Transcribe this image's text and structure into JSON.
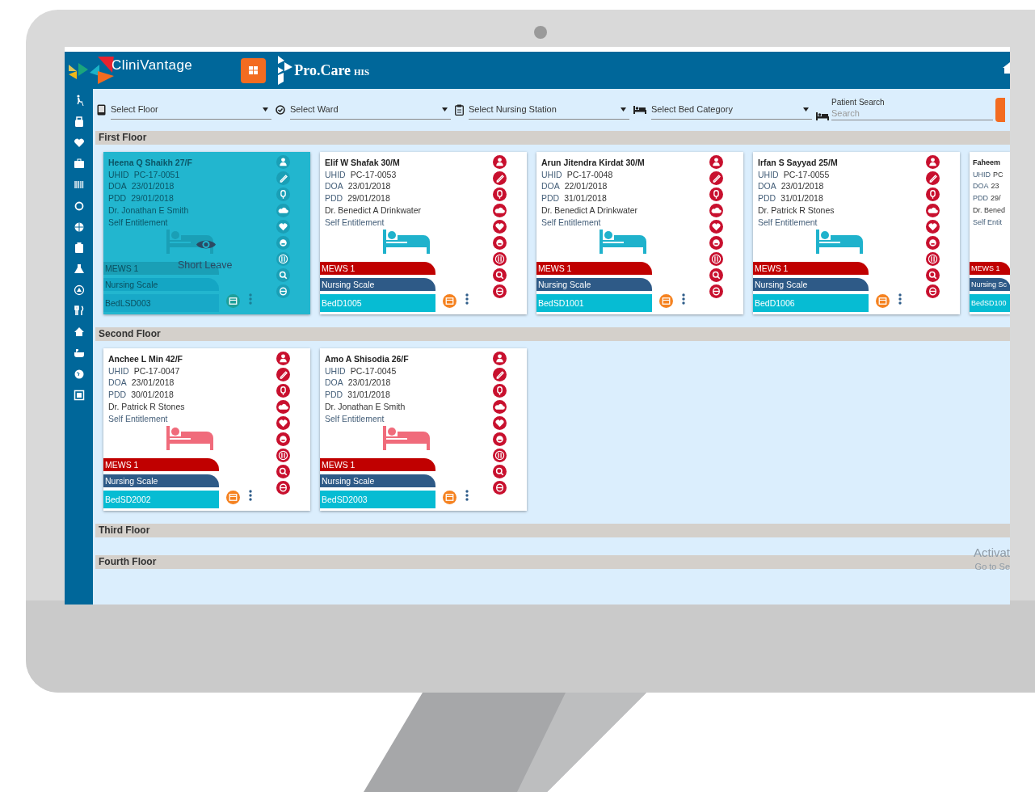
{
  "header": {
    "logo_text": "CliniVantage",
    "brand": "Pro.Care",
    "brand_suffix": "HIS"
  },
  "filters": [
    {
      "placeholder": "Select Floor"
    },
    {
      "placeholder": "Select Ward"
    },
    {
      "placeholder": "Select Nursing Station"
    },
    {
      "placeholder": "Select Bed Category"
    }
  ],
  "patient_search": {
    "label": "Patient Search",
    "placeholder": "Search"
  },
  "floors": [
    {
      "title": "First Floor",
      "cards": [
        {
          "kind": "full",
          "name": "Heena Q Shaikh 27/F",
          "uhid_label": "UHID",
          "uhid": "PC-17-0051",
          "doa_label": "DOA",
          "doa": "23/01/2018",
          "pdd_label": "PDD",
          "pdd": "29/01/2018",
          "doctor": "Dr. Jonathan E Smith",
          "entitlement": "Self Entitlement",
          "mews": "MEWS 1",
          "nursing": "Nursing Scale",
          "bed": "BedLSD003",
          "color": "#1a9fb6",
          "short_leave": true,
          "overlay_text": "Short Leave"
        },
        {
          "kind": "full",
          "name": "Elif W Shafak 30/M",
          "uhid_label": "UHID",
          "uhid": "PC-17-0053",
          "doa_label": "DOA",
          "doa": "23/01/2018",
          "pdd_label": "PDD",
          "pdd": "29/01/2018",
          "doctor": "Dr. Benedict A Drinkwater",
          "entitlement": "Self Entitlement",
          "mews": "MEWS 1",
          "nursing": "Nursing Scale",
          "bed": "BedD1005",
          "color": "#1fb2cc",
          "short_leave": false
        },
        {
          "kind": "full",
          "name": "Arun Jitendra Kirdat 30/M",
          "uhid_label": "UHID",
          "uhid": "PC-17-0048",
          "doa_label": "DOA",
          "doa": "22/01/2018",
          "pdd_label": "PDD",
          "pdd": "31/01/2018",
          "doctor": "Dr. Benedict A Drinkwater",
          "entitlement": "Self Entitlement",
          "mews": "MEWS 1",
          "nursing": "Nursing Scale",
          "bed": "BedSD1001",
          "color": "#1fb2cc",
          "short_leave": false
        },
        {
          "kind": "full",
          "name": "Irfan S Sayyad 25/M",
          "uhid_label": "UHID",
          "uhid": "PC-17-0055",
          "doa_label": "DOA",
          "doa": "23/01/2018",
          "pdd_label": "PDD",
          "pdd": "31/01/2018",
          "doctor": "Dr. Patrick R Stones",
          "entitlement": "Self Entitlement",
          "mews": "MEWS 1",
          "nursing": "Nursing Scale",
          "bed": "BedD1006",
          "color": "#1fb2cc",
          "short_leave": false
        },
        {
          "kind": "partial",
          "name": "Faheem",
          "uhid_label": "UHID",
          "uhid": "PC",
          "doa_label": "DOA",
          "doa": "23",
          "pdd_label": "PDD",
          "pdd": "29/",
          "doctor": "Dr. Bened",
          "entitlement": "Self Entit",
          "mews": "MEWS 1",
          "nursing": "Nursing Sc",
          "bed": "BedSD100"
        }
      ]
    },
    {
      "title": "Second Floor",
      "cards": [
        {
          "kind": "full",
          "name": "Anchee L Min 42/F",
          "uhid_label": "UHID",
          "uhid": "PC-17-0047",
          "doa_label": "DOA",
          "doa": "23/01/2018",
          "pdd_label": "PDD",
          "pdd": "30/01/2018",
          "doctor": "Dr. Patrick R Stones",
          "entitlement": "Self Entitlement",
          "mews": "MEWS 1",
          "nursing": "Nursing Scale",
          "bed": "BedSD2002",
          "color": "#f06b7b",
          "short_leave": false
        },
        {
          "kind": "full",
          "name": "Amo A Shisodia 26/F",
          "uhid_label": "UHID",
          "uhid": "PC-17-0045",
          "doa_label": "DOA",
          "doa": "23/01/2018",
          "pdd_label": "PDD",
          "pdd": "31/01/2018",
          "doctor": "Dr. Jonathan E Smith",
          "entitlement": "Self Entitlement",
          "mews": "MEWS 1",
          "nursing": "Nursing Scale",
          "bed": "BedSD2003",
          "color": "#f06b7b",
          "short_leave": false
        }
      ]
    },
    {
      "title": "Third Floor"
    },
    {
      "title": "Fourth Floor"
    }
  ],
  "activation_notice": {
    "title": "Activat",
    "subtitle": "Go to Se"
  }
}
